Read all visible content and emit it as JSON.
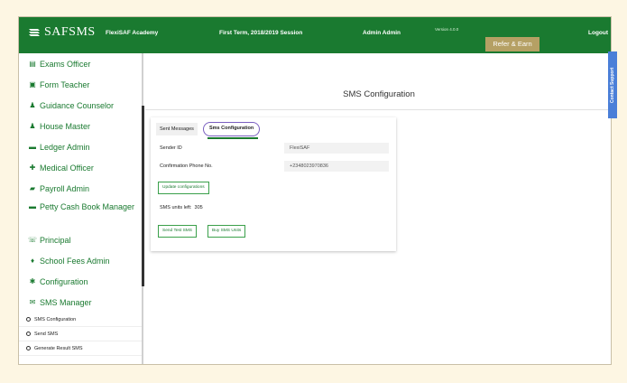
{
  "topbar": {
    "logo": "SAFSMS",
    "school": "FlexiSAF Academy",
    "term": "First Term, 2018/2019 Session",
    "user": "Admin Admin",
    "version": "Version 4.0.0",
    "refer": "Refer & Earn",
    "logout": "Logout",
    "color": "#1a7a30"
  },
  "sidebar": {
    "items": [
      {
        "label": "Exams Officer",
        "icon": "exams-icon"
      },
      {
        "label": "Form Teacher",
        "icon": "form-icon"
      },
      {
        "label": "Guidance Counselor",
        "icon": "person-icon"
      },
      {
        "label": "House Master",
        "icon": "person-icon"
      },
      {
        "label": "Ledger Admin",
        "icon": "ledger-icon"
      },
      {
        "label": "Medical Officer",
        "icon": "medical-icon"
      },
      {
        "label": "Payroll Admin",
        "icon": "money-icon"
      },
      {
        "label": "Petty Cash Book Manager",
        "icon": "cash-icon"
      },
      {
        "label": "Principal",
        "icon": "principal-icon"
      },
      {
        "label": "School Fees Admin",
        "icon": "fees-icon"
      },
      {
        "label": "Configuration",
        "icon": "gear-icon"
      },
      {
        "label": "SMS Manager",
        "icon": "envelope-icon"
      }
    ],
    "sub_items": [
      "SMS Configuration",
      "Send SMS",
      "Generate Result SMS"
    ]
  },
  "main": {
    "title": "SMS Configuration",
    "tabs": [
      "Sent Messages",
      "Sms Configuration"
    ],
    "sender_label": "Sender ID",
    "sender_value": "FlexiSAF",
    "phone_label": "Confirmation Phone No.",
    "phone_value": "+2348023970836",
    "update_button": "Update configurations",
    "units_label": "SMS units left:",
    "units_value": "305",
    "test_button": "Send Test SMS",
    "buy_button": "Buy SMS Units"
  },
  "support": "Contact Support"
}
